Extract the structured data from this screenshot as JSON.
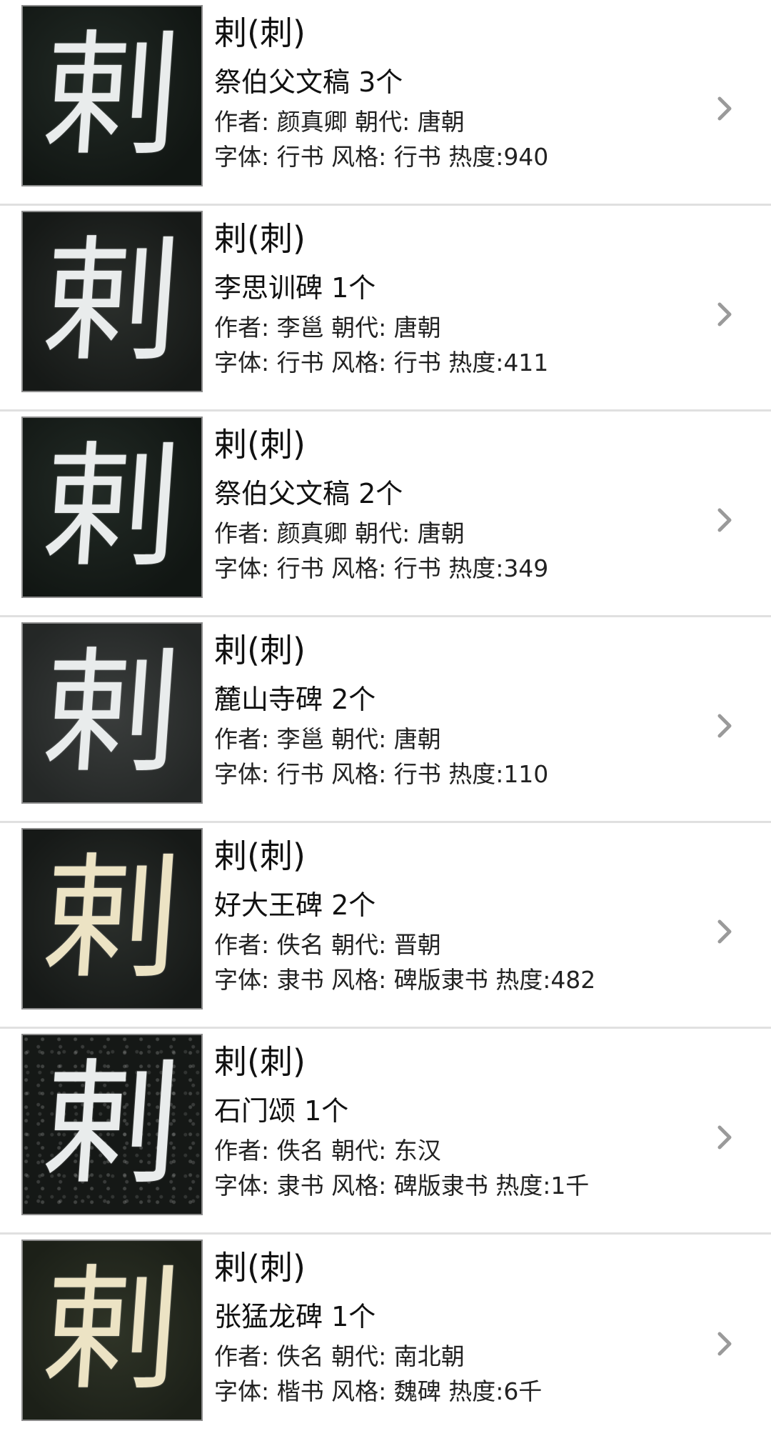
{
  "items": [
    {
      "title": "剌(刺)",
      "work": "祭伯父文稿 3个",
      "author_line": "作者: 颜真卿 朝代: 唐朝",
      "style_line": "字体: 行书 风格: 行书 热度:940",
      "glyph": "剌",
      "icon": "chevron-right-icon"
    },
    {
      "title": "剌(刺)",
      "work": "李思训碑 1个",
      "author_line": "作者: 李邕 朝代: 唐朝",
      "style_line": "字体: 行书 风格: 行书 热度:411",
      "glyph": "剌",
      "icon": "chevron-right-icon"
    },
    {
      "title": "剌(刺)",
      "work": "祭伯父文稿 2个",
      "author_line": "作者: 颜真卿 朝代: 唐朝",
      "style_line": "字体: 行书 风格: 行书 热度:349",
      "glyph": "剌",
      "icon": "chevron-right-icon"
    },
    {
      "title": "剌(刺)",
      "work": "麓山寺碑 2个",
      "author_line": "作者: 李邕 朝代: 唐朝",
      "style_line": "字体: 行书 风格: 行书 热度:110",
      "glyph": "剌",
      "icon": "chevron-right-icon"
    },
    {
      "title": "剌(刺)",
      "work": "好大王碑 2个",
      "author_line": "作者: 佚名 朝代: 晋朝",
      "style_line": "字体: 隶书 风格: 碑版隶书 热度:482",
      "glyph": "剌",
      "icon": "chevron-right-icon"
    },
    {
      "title": "剌(刺)",
      "work": "石门颂 1个",
      "author_line": "作者: 佚名 朝代: 东汉",
      "style_line": "字体: 隶书 风格: 碑版隶书 热度:1千",
      "glyph": "剌",
      "icon": "chevron-right-icon"
    },
    {
      "title": "剌(刺)",
      "work": "张猛龙碑 1个",
      "author_line": "作者: 佚名 朝代: 南北朝",
      "style_line": "字体: 楷书 风格: 魏碑 热度:6千",
      "glyph": "剌",
      "icon": "chevron-right-icon"
    }
  ]
}
